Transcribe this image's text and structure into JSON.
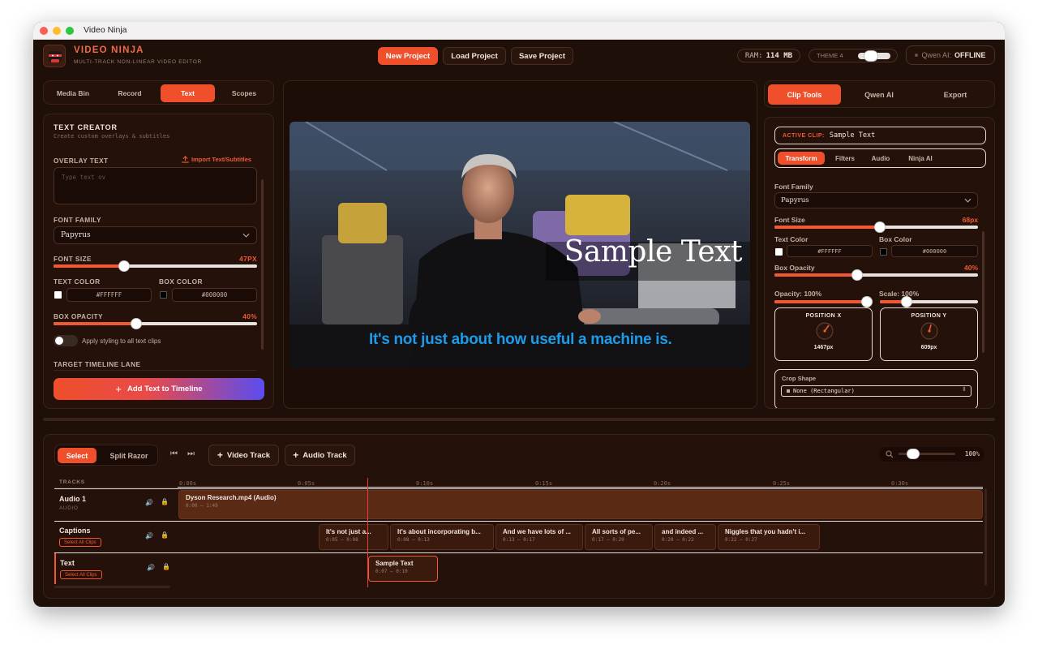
{
  "window": {
    "title": "Video Ninja"
  },
  "app": {
    "name": "VIDEO NINJA",
    "subtitle": "MULTI-TRACK NON-LINEAR VIDEO EDITOR"
  },
  "header": {
    "new_project": "New Project",
    "load_project": "Load Project",
    "save_project": "Save Project",
    "ram_label": "RAM:",
    "ram_value": "114 MB",
    "theme_label": "THEME 4",
    "ai_label": "Qwen AI:",
    "ai_status": "OFFLINE"
  },
  "left_tabs": [
    "Media Bin",
    "Record",
    "Text",
    "Scopes"
  ],
  "text_creator": {
    "title": "TEXT CREATOR",
    "subtitle": "Create custom overlays & subtitles",
    "overlay_label": "OVERLAY TEXT",
    "import_label": "Import Text/Subtitles",
    "overlay_placeholder": "Type text ov",
    "font_family_label": "FONT FAMILY",
    "font_family_value": "Papyrus",
    "font_size_label": "FONT SIZE",
    "font_size_value": "47PX",
    "font_size_fraction": 0.34,
    "text_color_label": "TEXT COLOR",
    "text_color_value": "#FFFFFF",
    "box_color_label": "BOX COLOR",
    "box_color_value": "#000000",
    "box_opacity_label": "BOX OPACITY",
    "box_opacity_value": "40%",
    "box_opacity_fraction": 0.4,
    "apply_all_label": "Apply styling to all text clips",
    "target_lane_label": "TARGET TIMELINE LANE",
    "add_button": "Add Text to Timeline"
  },
  "preview": {
    "overlay_text": "Sample Text",
    "subtitle_text": "It's not just about how useful a machine is."
  },
  "right_tabs": [
    "Clip Tools",
    "Qwen AI",
    "Export"
  ],
  "clip_tools": {
    "active_clip_label": "ACTIVE CLIP:",
    "active_clip_value": "Sample Text",
    "sub_tabs": [
      "Transform",
      "Filters",
      "Audio",
      "Ninja AI"
    ],
    "font_family_label": "Font Family",
    "font_family_value": "Papyrus",
    "font_size_label": "Font Size",
    "font_size_value": "68px",
    "font_size_fraction": 0.52,
    "text_color_label": "Text Color",
    "text_color_value": "#FFFFFF",
    "box_color_label": "Box Color",
    "box_color_value": "#000000",
    "box_opacity_label": "Box Opacity",
    "box_opacity_value": "40%",
    "box_opacity_fraction": 0.4,
    "opacity_label": "Opacity: 100%",
    "opacity_fraction": 1.0,
    "scale_label": "Scale: 100%",
    "scale_fraction": 0.25,
    "position_x_label": "POSITION X",
    "position_x_value": "1467px",
    "position_y_label": "POSITION Y",
    "position_y_value": "609px",
    "crop_shape_label": "Crop Shape",
    "crop_shape_value": "None (Rectangular)"
  },
  "timeline": {
    "select_label": "Select",
    "razor_label": "Split Razor",
    "video_track_label": "Video Track",
    "audio_track_label": "Audio Track",
    "zoom_value": "100%",
    "zoom_fraction": 0.2,
    "tracks_header": "TRACKS",
    "ruler": [
      "0:00s",
      "0:05s",
      "0:10s",
      "0:15s",
      "0:20s",
      "0:25s",
      "0:30s"
    ],
    "select_all": "Select All Clips",
    "tracks": [
      {
        "name": "Audio 1",
        "sub": "AUDIO"
      },
      {
        "name": "Captions",
        "sub": ""
      },
      {
        "name": "Text",
        "sub": ""
      }
    ],
    "audio_clip": {
      "title": "Dyson Research.mp4 (Audio)",
      "time": "0:00 – 1:49"
    },
    "caption_clips": [
      {
        "title": "It's not just a...",
        "time": "0:05 – 0:08"
      },
      {
        "title": "It's about incorporating b...",
        "time": "0:08 – 0:13"
      },
      {
        "title": "And we have lots of ...",
        "time": "0:13 – 0:17"
      },
      {
        "title": "All sorts of pe...",
        "time": "0:17 – 0:20"
      },
      {
        "title": "and indeed ...",
        "time": "0:20 – 0:22"
      },
      {
        "title": "Niggles that you hadn't i...",
        "time": "0:22 – 0:27"
      }
    ],
    "text_clip": {
      "title": "Sample Text",
      "time": "0:07 – 0:10"
    }
  },
  "colors": {
    "accent": "#ef4f2a",
    "background": "#1e0f09",
    "subtitle": "#1e9be8"
  }
}
